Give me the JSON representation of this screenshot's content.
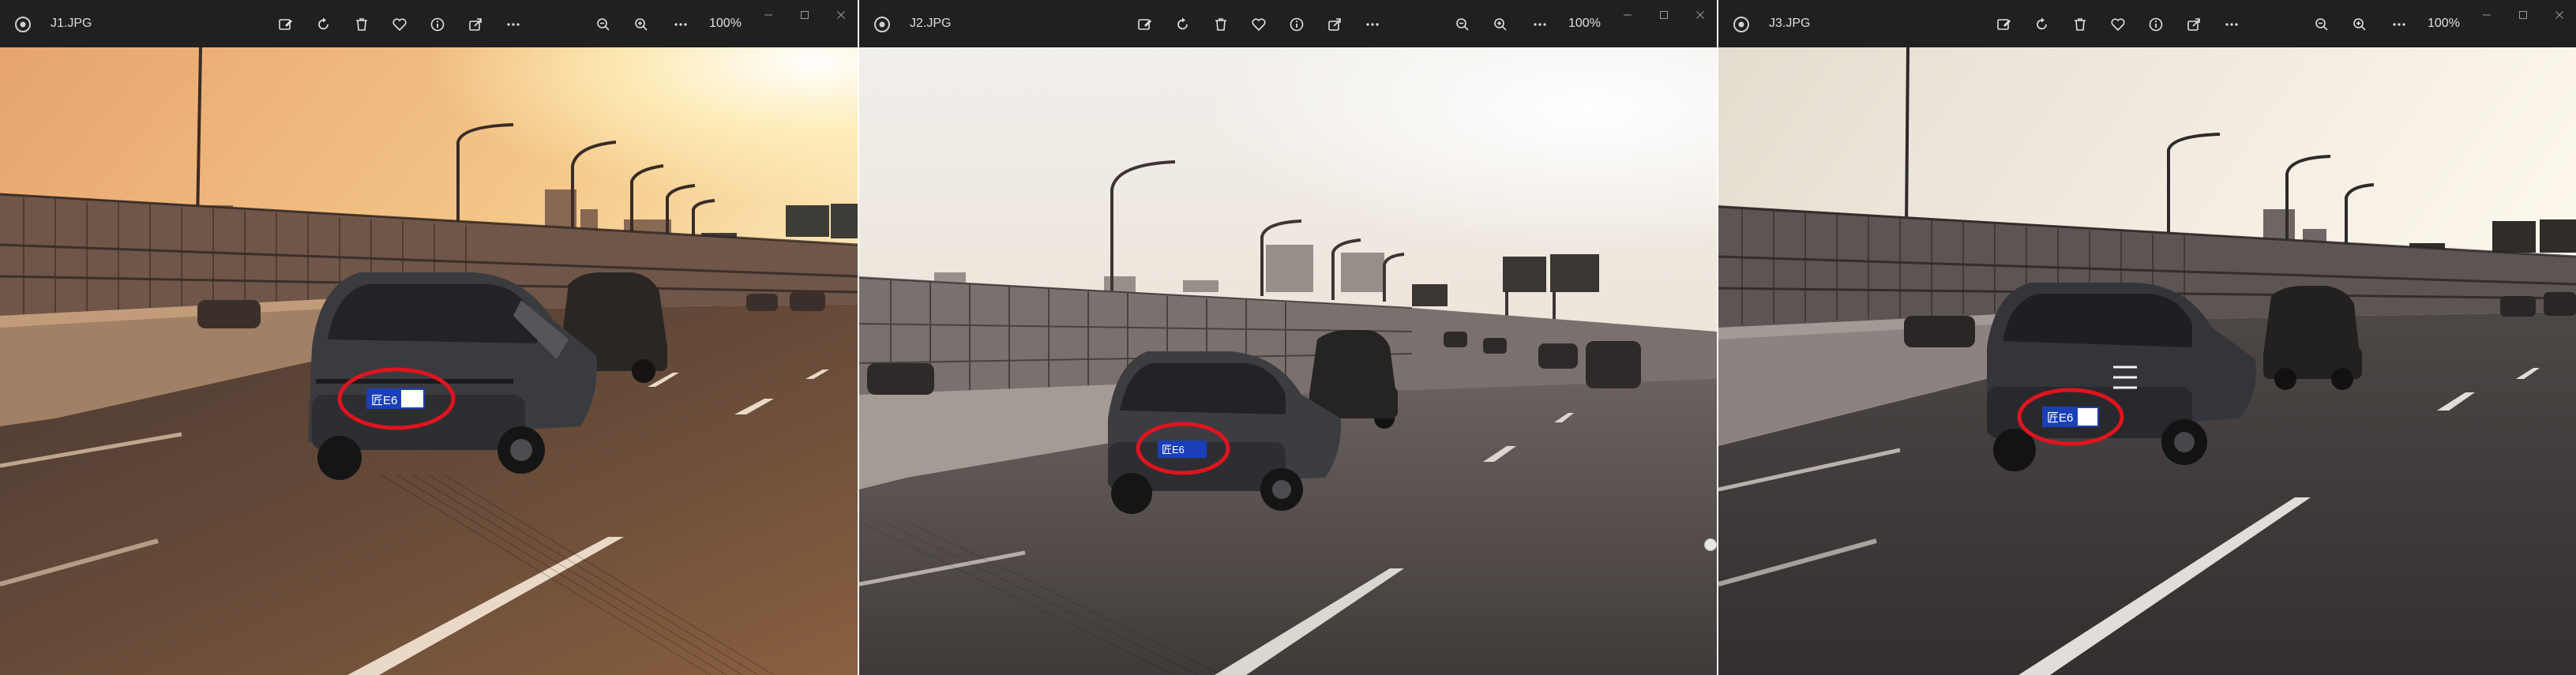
{
  "windows": [
    {
      "file_name": "J1.JPG",
      "zoom": "100%",
      "plate_text": "匠E6",
      "tone": "golden",
      "colors": {
        "sky_top": "#f2c08a",
        "sun": "#fff6cc",
        "road": "#5a4436",
        "ellipse": "#e0141e",
        "plate": "#1a3fb8"
      }
    },
    {
      "file_name": "J2.JPG",
      "zoom": "100%",
      "plate_text": "匠E6",
      "tone": "hazy",
      "colors": {
        "sky_top": "#e9e6e1",
        "sun": "#ffffff",
        "road": "#4a4644",
        "ellipse": "#e0141e",
        "plate": "#1a3fb8"
      }
    },
    {
      "file_name": "J3.JPG",
      "zoom": "100%",
      "plate_text": "匠E6",
      "tone": "dim",
      "colors": {
        "sky_top": "#ede6dc",
        "sun": "#ffffff",
        "road": "#3c3a3a",
        "ellipse": "#e0141e",
        "plate": "#1a3fb8"
      }
    }
  ],
  "toolbar_icons": [
    "edit-image-icon",
    "rotate-icon",
    "delete-icon",
    "favorite-icon",
    "info-icon",
    "share-icon",
    "more-icon"
  ],
  "zoom_icons": [
    "zoom-out-icon",
    "zoom-in-icon",
    "more-options-icon"
  ],
  "window_controls": [
    "minimize-icon",
    "maximize-icon",
    "close-icon"
  ]
}
